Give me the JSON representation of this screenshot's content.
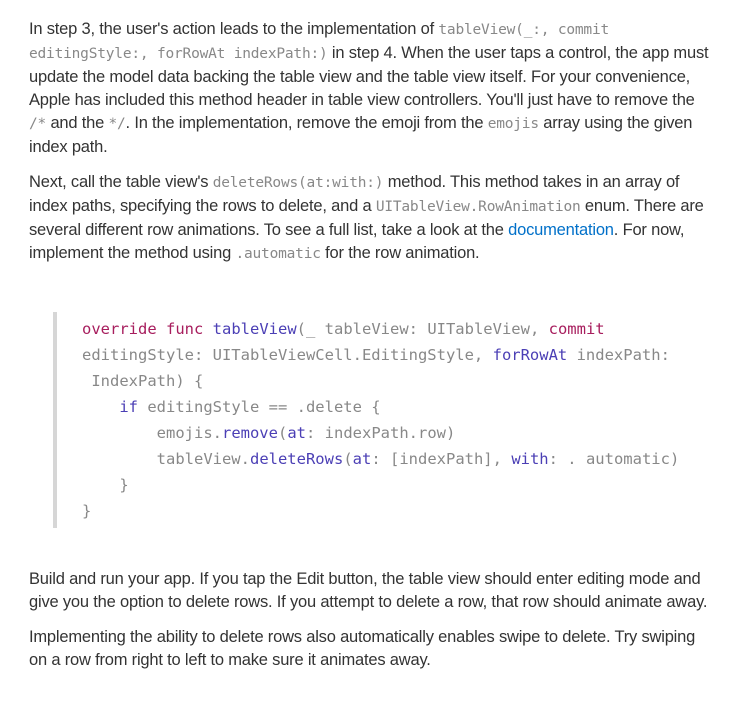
{
  "para1": {
    "t1": "In step 3, the user's action leads to the implementation of ",
    "c1": "tableView(_:, commit editingStyle:, forRowAt indexPath:)",
    "t2": " in step 4. When the user taps a control, the app must update the model data backing the table view and the table view itself. For your convenience, Apple has included this method header in table view controllers. You'll just have to remove the ",
    "c2": "/*",
    "t3": " and the ",
    "c3": "*/",
    "t4": ". In the implementation, remove the emoji from the ",
    "c4": "emojis",
    "t5": " array using the given index path."
  },
  "para2": {
    "t1": "Next, call the table view's ",
    "c1": "deleteRows(at:with:)",
    "t2": " method. This method takes in an array of index paths, specifying the rows to delete, and a ",
    "c2": "UITableView.RowAnimation",
    "t3": " enum. There are several different row animations. To see a full list, take a look at the ",
    "link": "documentation",
    "t4": ". For now, implement the method using ",
    "c3": ".automatic",
    "t5": " for the row animation."
  },
  "code": {
    "l1": {
      "kw1": "override",
      "kw2": "func",
      "fn": "tableView",
      "rest": "(_ tableView: UITableView, ",
      "kw3": "commit"
    },
    "l2": {
      "a": "editingStyle: UITableViewCell.EditingStyle, ",
      "kw": "forRowAt",
      "b": " indexPath:"
    },
    "l3": " IndexPath) {",
    "l4": {
      "indent": "    ",
      "kw": "if",
      "rest": " editingStyle == .delete {"
    },
    "l5": {
      "indent": "        ",
      "a": "emojis.",
      "fn": "remove",
      "b": "(",
      "kw": "at",
      "c": ": indexPath.row)"
    },
    "l6": {
      "indent": "        ",
      "a": "tableView.",
      "fn": "deleteRows",
      "b": "(",
      "kw1": "at",
      "c": ": [indexPath], ",
      "kw2": "with",
      "d": ": . automatic)"
    },
    "l7": "    }",
    "l8": "}"
  },
  "para3": "Build and run your app. If you tap the Edit button, the table view should enter editing mode and give you the option to delete rows. If you attempt to delete a row, that row should animate away.",
  "para4": "Implementing the ability to delete rows also automatically enables swipe to delete. Try swiping on a row from right to left to make sure it animates away.",
  "colors": {
    "text": "#333333",
    "inline_code": "#888888",
    "link": "#0070c9",
    "keyword": "#a71d5d",
    "function": "#4b3fb5",
    "code_border": "#d6d6d6"
  }
}
